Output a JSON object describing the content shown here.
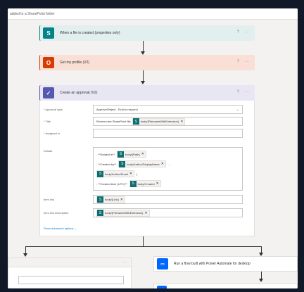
{
  "topbar": {
    "text": "added to a SharePoint folder"
  },
  "steps": [
    {
      "title": "When a file is created (properties only)",
      "icon_text": "S",
      "icon_name": "sharepoint-icon",
      "color": "#038387",
      "bg": "#e1efee"
    },
    {
      "title": "Get my profile (V2)",
      "icon_text": "O",
      "icon_name": "office365-icon",
      "color": "#d83b01",
      "bg": "#f9dfd6"
    },
    {
      "title": "Create an approval (V2)",
      "icon_text": "✓",
      "icon_name": "approvals-icon",
      "color": "#5558af",
      "bg": "#e8e6f3"
    }
  ],
  "card_actions": {
    "help": "?",
    "more": "···"
  },
  "approval": {
    "approval_type_label": "* Approval type",
    "approval_type_value": "Approve/Reject - First to respond",
    "title_label": "* Title",
    "title_text": "Review new SharePoint file",
    "title_token": "body/{FilenameWithExtension}",
    "assigned_to_label": "* Assigned to",
    "details_label": "Details",
    "details_rows": [
      {
        "prefix": "- **Subject is**",
        "token": "body/{Path}",
        "suffix": ""
      },
      {
        "prefix": "- **Created by**",
        "token": "body/Author/DisplayName",
        "suffix": "→"
      },
      {
        "prefix": "",
        "token": "body/Author/Email",
        "suffix": ")"
      },
      {
        "prefix": "- **Created time (UTC)**",
        "token": "body/Created",
        "suffix": ""
      }
    ],
    "item_link_label": "Item link",
    "item_link_token": "body/{Link}",
    "item_link_desc_label": "Item link description",
    "item_link_desc_token": "body/{FilenameWithExtension}",
    "advanced_label": "Show advanced options",
    "advanced_chevron": "⌄"
  },
  "branch_right": {
    "title": "Run a flow built with Power Automate for desktop"
  },
  "colors": {
    "canvas": "#f3f2f1",
    "link": "#0078d4",
    "token": "#0f6e70"
  }
}
